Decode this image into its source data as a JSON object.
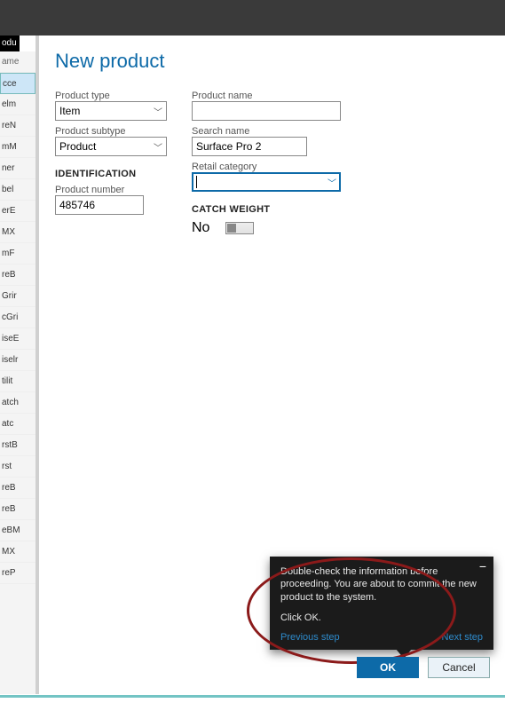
{
  "leftTab": "odu",
  "sidebar": {
    "header": "ame",
    "items": [
      "cce",
      "elm",
      "reN",
      "mM",
      "ner",
      "bel",
      "erE",
      "MX",
      "mF",
      "reB",
      "Grir",
      "cGri",
      "iseE",
      "iselr",
      "tilit",
      "atch",
      "atc",
      "rstB",
      "rst",
      "reB",
      "reB",
      "eBM",
      "MX",
      "reP"
    ]
  },
  "dialog": {
    "title": "New product",
    "labels": {
      "productType": "Product type",
      "productSubtype": "Product subtype",
      "productName": "Product name",
      "searchName": "Search name",
      "retailCategory": "Retail category",
      "productNumber": "Product number",
      "identification": "IDENTIFICATION",
      "catchWeight": "CATCH WEIGHT"
    },
    "values": {
      "productType": "Item",
      "productSubtype": "Product",
      "productName": "",
      "searchName": "Surface Pro 2",
      "retailCategory": "",
      "productNumber": "485746",
      "catchWeightNo": "No"
    },
    "buttons": {
      "ok": "OK",
      "cancel": "Cancel"
    }
  },
  "tooltip": {
    "body": "Double-check the information before proceeding. You are about to commit the new product to the system.",
    "action": "Click OK.",
    "prev": "Previous step",
    "next": "Next step"
  }
}
